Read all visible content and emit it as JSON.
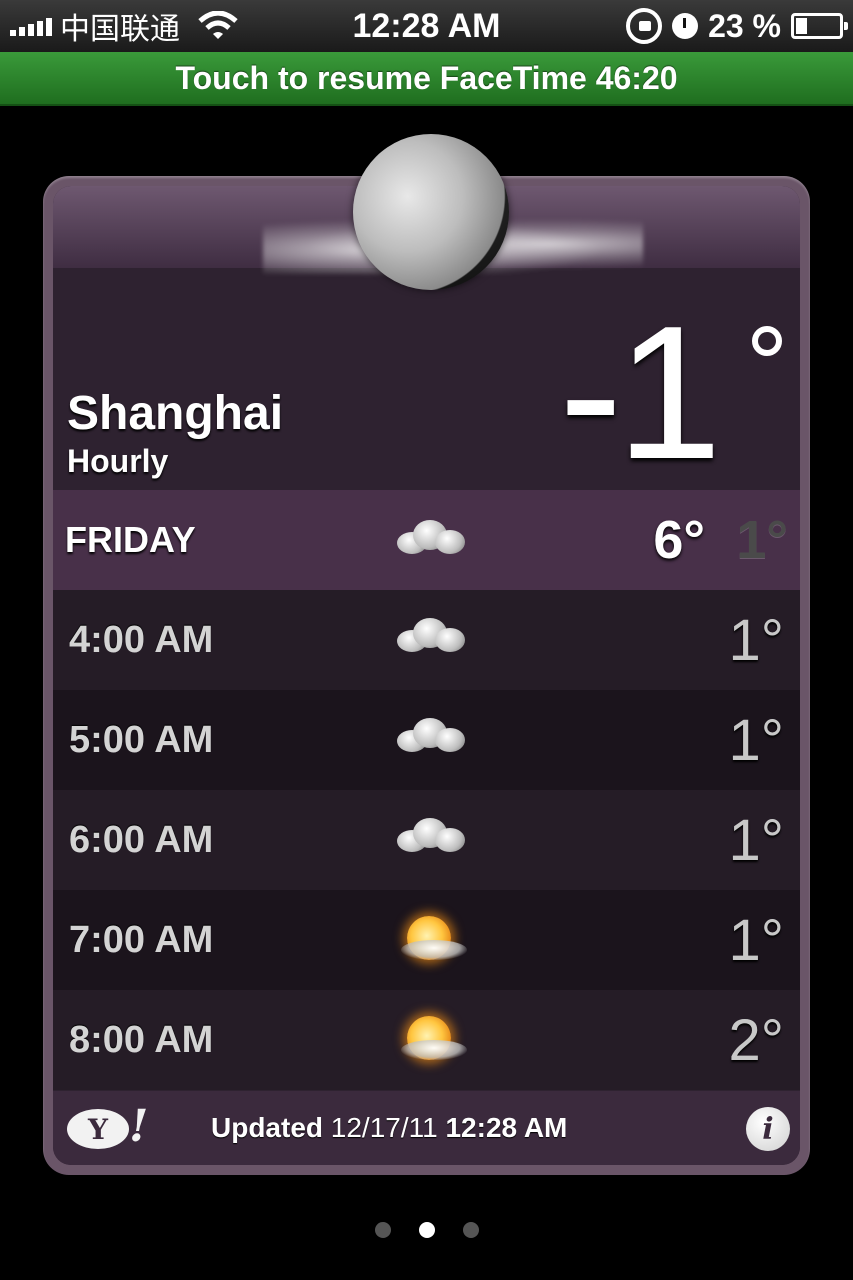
{
  "status_bar": {
    "carrier": "中国联通",
    "time": "12:28 AM",
    "battery_percent": "23 %",
    "battery_level": 0.23,
    "icons": [
      "signal-bars-icon",
      "wifi-icon",
      "rotation-lock-icon",
      "alarm-icon",
      "battery-icon"
    ]
  },
  "facetime_bar": {
    "label": "Touch to resume FaceTime 46:20"
  },
  "weather": {
    "city": "Shanghai",
    "mode": "Hourly",
    "current_temp": "-1",
    "current_condition_icon": "moon-cloudy-icon",
    "day": {
      "label": "FRIDAY",
      "high": "6°",
      "low": "1°",
      "icon": "cloudy-icon"
    },
    "hours": [
      {
        "time": "4:00 AM",
        "temp": "1°",
        "icon": "cloudy-icon"
      },
      {
        "time": "5:00 AM",
        "temp": "1°",
        "icon": "cloudy-icon"
      },
      {
        "time": "6:00 AM",
        "temp": "1°",
        "icon": "cloudy-icon"
      },
      {
        "time": "7:00 AM",
        "temp": "1°",
        "icon": "partly-sunny-icon"
      },
      {
        "time": "8:00 AM",
        "temp": "2°",
        "icon": "partly-sunny-icon"
      }
    ],
    "footer": {
      "updated_label": "Updated",
      "updated_date": "12/17/11",
      "updated_time": "12:28 AM",
      "logo_text": "Y",
      "logo_bang": "!",
      "info_glyph": "i"
    }
  },
  "page_control": {
    "count": 3,
    "current": 2
  },
  "colors": {
    "card_frame": "#6a5568",
    "card_bg": "#2e2230",
    "day_row": "#483049",
    "facetime_green": "#2f8a2f"
  }
}
